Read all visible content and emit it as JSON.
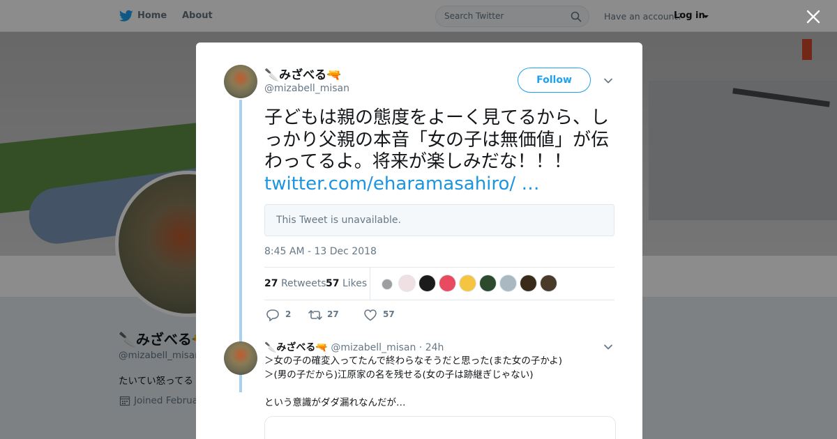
{
  "nav": {
    "home": "Home",
    "about": "About",
    "search_placeholder": "Search Twitter",
    "have_account": "Have an account?",
    "login": "Log in"
  },
  "profile": {
    "name": "🔪みざべる🔫",
    "handle": "@mizabell_misan",
    "bio": "たいてい怒ってる",
    "joined": "Joined Februa"
  },
  "tweet": {
    "name": "🔪みざべる🔫",
    "handle": "@mizabell_misan",
    "follow_label": "Follow",
    "text": "子どもは親の態度をよーく見てるから、しっかり父親の本音「女の子は無価値」が伝わってるよ。将来が楽しみだな！！！ ",
    "link_text": "twitter.com/eharamasahiro/ …",
    "unavailable": "This Tweet is unavailable.",
    "timestamp": "8:45 AM - 13 Dec 2018",
    "retweets_count": "27",
    "retweets_label": "Retweets",
    "likes_count": "57",
    "likes_label": "Likes",
    "actions": {
      "replies": "2",
      "retweets": "27",
      "likes": "57"
    },
    "liker_avatar_colors": [
      "#9e9e9e",
      "#f0e0e4",
      "#1b1b1b",
      "#e84a5f",
      "#f5c542",
      "#2d4a2d",
      "#aab8c2",
      "#3a2a1a",
      "#4a3a2a"
    ]
  },
  "reply": {
    "name": "🔪みざべる🔫",
    "handle": "@mizabell_misan",
    "time": "· 24h",
    "body": "＞女の子の確変入ってたんで終わらなそうだと思った(また女の子かよ)\n＞(男の子だから)江原家の名を残せる(女の子は跡継ぎじゃない)\n\nという意識がダダ漏れなんだが…"
  },
  "colors": {
    "accent": "#1da1f2",
    "link": "#1b95e0",
    "thread_line": "#a5d1f3"
  }
}
